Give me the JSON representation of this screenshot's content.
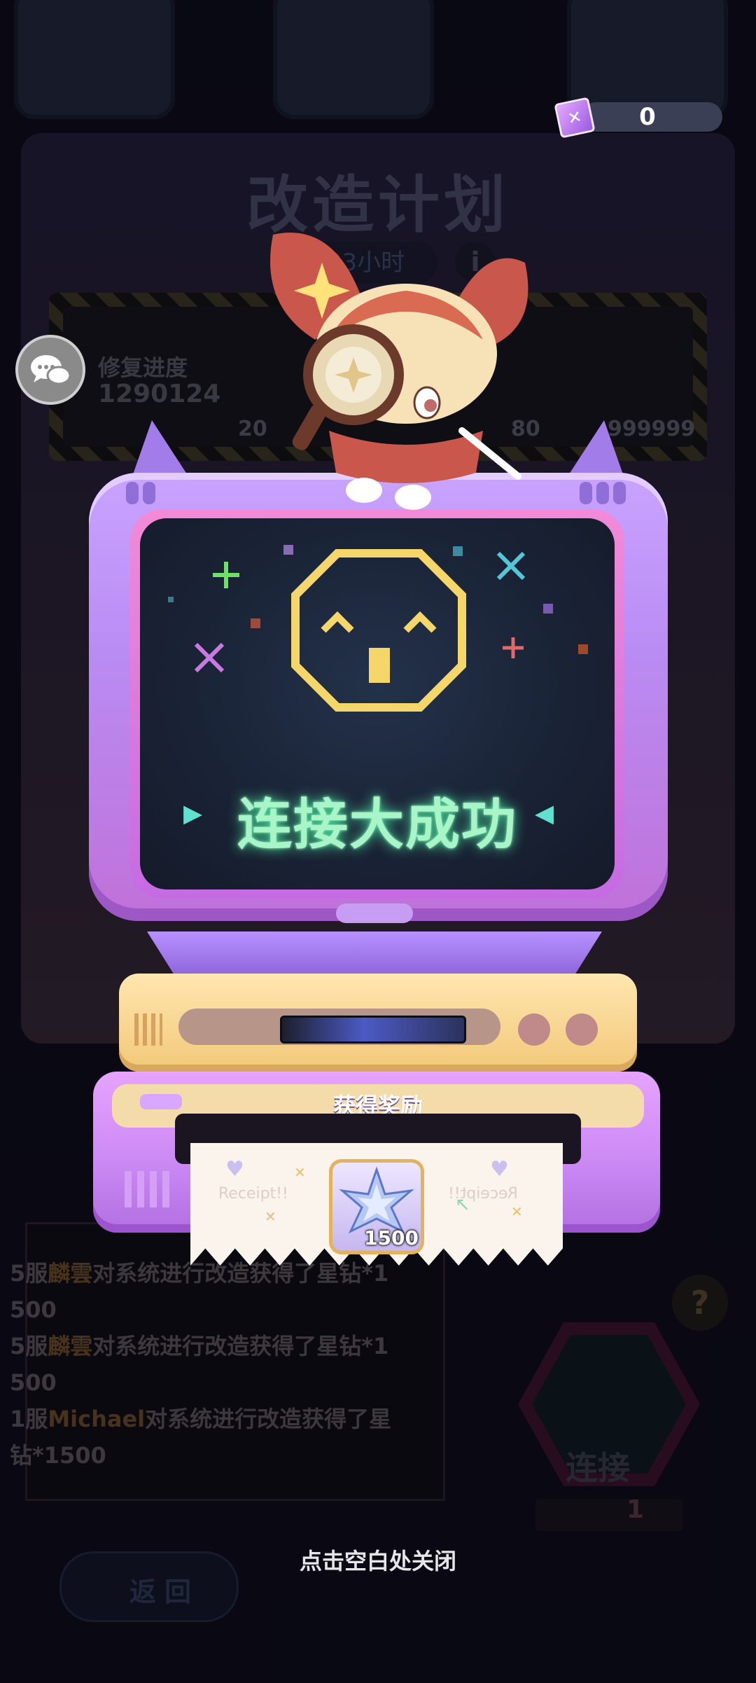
{
  "background": {
    "title": "改造计划",
    "timer": "23小时",
    "info_symbol": "i",
    "progress_label": "修复进度",
    "progress_value": "1290124",
    "milestones": [
      "20",
      "80",
      "999999"
    ],
    "log_lines": [
      {
        "prefix": "5服",
        "name": "麟雲",
        "suffix": "对系统进行改造获得了星钻*1"
      },
      {
        "prefix": "",
        "name": "",
        "suffix": "500"
      },
      {
        "prefix": "5服",
        "name": "麟雲",
        "suffix": "对系统进行改造获得了星钻*1"
      },
      {
        "prefix": "",
        "name": "",
        "suffix": "500"
      },
      {
        "prefix": "1服",
        "name": "Michael",
        "suffix": "对系统进行改造获得了星"
      },
      {
        "prefix": "",
        "name": "",
        "suffix": "钻*1500"
      }
    ],
    "connect_label": "连接",
    "connect_cost": "1",
    "help_symbol": "?",
    "back_label": "返回"
  },
  "currency": {
    "value": "0",
    "icon": "gem-ticket-icon"
  },
  "chat": {
    "icon": "chat-bubble-icon"
  },
  "popup": {
    "result_text": "连接大成功",
    "reward_title": "获得奖励",
    "receipt_watermark": "Receipt!!",
    "reward": {
      "icon": "star-diamond-icon",
      "count": "1500"
    },
    "close_hint": "点击空白处关闭"
  },
  "colors": {
    "success_glow": "#4ff0a3",
    "pixel_face": "#f5d66a",
    "monitor_purple": "#b98cf3",
    "drive_cream": "#f2c879"
  }
}
